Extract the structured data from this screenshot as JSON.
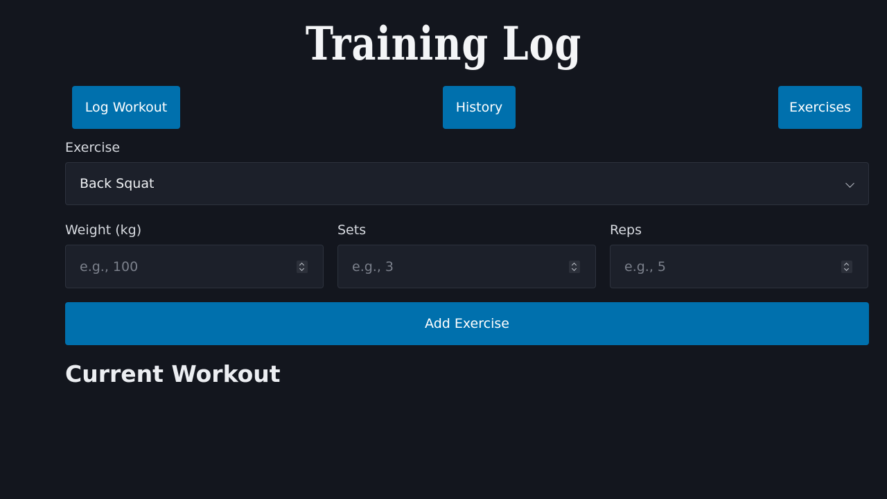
{
  "app": {
    "title": "Training Log"
  },
  "nav": {
    "log_workout": "Log Workout",
    "history": "History",
    "exercises": "Exercises"
  },
  "form": {
    "exercise": {
      "label": "Exercise",
      "selected": "Back Squat"
    },
    "weight": {
      "label": "Weight (kg)",
      "placeholder": "e.g., 100",
      "value": ""
    },
    "sets": {
      "label": "Sets",
      "placeholder": "e.g., 3",
      "value": ""
    },
    "reps": {
      "label": "Reps",
      "placeholder": "e.g., 5",
      "value": ""
    },
    "submit_label": "Add Exercise"
  },
  "current_workout": {
    "title": "Current Workout",
    "items": []
  },
  "colors": {
    "background": "#13161e",
    "accent": "#0070ad",
    "field_background": "#1c202a"
  },
  "icons": {
    "select_chevron": "chevron-down-icon",
    "number_spinner": "spinner-icon"
  }
}
